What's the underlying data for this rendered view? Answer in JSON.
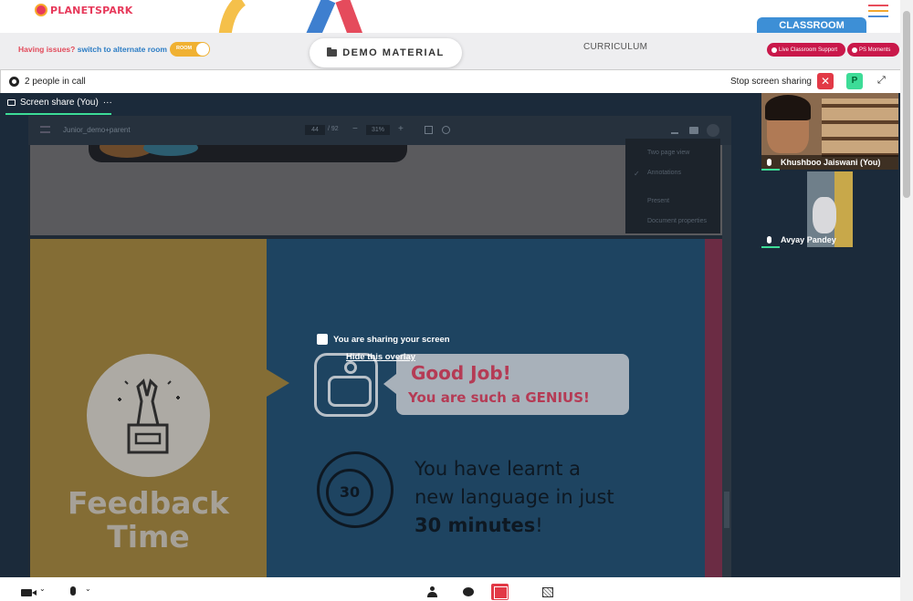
{
  "header": {
    "brand": "PLANETSPARK",
    "classroom_tab": "CLASSROOM",
    "issue_text": "Having issues?",
    "issue_link": "switch to alternate room",
    "room_toggle_label": "ROOM",
    "demo_material": "DEMO MATERIAL",
    "curriculum": "CURRICULUM",
    "live_support": "Live Classroom Support",
    "ps_moments": "PS Moments"
  },
  "call_toolbar": {
    "people_count": "2 people in call",
    "stop_sharing": "Stop screen sharing",
    "close_symbol": "✕",
    "participant_initial": "P",
    "fullscreen_symbol": "⤢"
  },
  "share_tab": {
    "label": "Screen share (You)",
    "more": "···"
  },
  "pdf_viewer": {
    "file_name": "Junior_demo+parent",
    "page_current": "44",
    "page_total": "/ 92",
    "zoom": "31%",
    "zoom_out": "−",
    "zoom_in": "+",
    "menu_items": [
      "Two page view",
      "Annotations",
      "Present",
      "Document properties"
    ],
    "checked_item": "Annotations"
  },
  "slide": {
    "feedback_title_line1": "Feedback",
    "feedback_title_line2": "Time",
    "good_job": "Good Job!",
    "genius": "You are such a GENIUS!",
    "timer_value": "30",
    "learnt_line1": "You have learnt a",
    "learnt_line2": "new language in just",
    "learnt_line3": "30 minutes",
    "learnt_suffix": "!"
  },
  "overlay": {
    "sharing_text": "You are sharing your screen",
    "hide_link": "Hide this overlay"
  },
  "participants": [
    {
      "name": "Khushboo Jaiswani (You)"
    },
    {
      "name": "Avyay Pandey"
    }
  ],
  "colors": {
    "accent_green": "#3ddc97",
    "danger_red": "#e23946",
    "brand_blue": "#3d8fd6",
    "brand_pink": "#c9184a"
  }
}
